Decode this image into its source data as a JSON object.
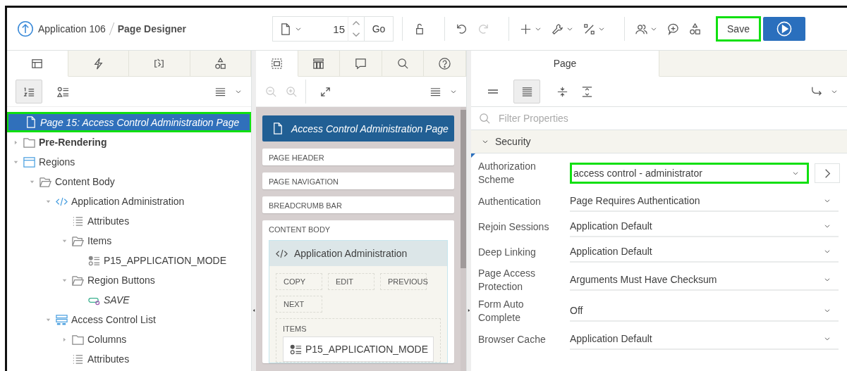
{
  "header": {
    "app_link": "Application 106",
    "page_title": "Page Designer",
    "page_number": "15",
    "go_label": "Go",
    "tool_groups": [
      [
        {
          "kind": "lock",
          "menu": false,
          "disabled": false
        }
      ],
      [
        {
          "kind": "undo",
          "menu": false,
          "disabled": false
        },
        {
          "kind": "redo",
          "menu": false,
          "disabled": true
        }
      ],
      [
        {
          "kind": "add",
          "menu": true,
          "disabled": false
        },
        {
          "kind": "utilities",
          "menu": true,
          "disabled": false
        },
        {
          "kind": "shared",
          "menu": true,
          "disabled": false
        }
      ],
      [
        {
          "kind": "team",
          "menu": true,
          "disabled": false
        },
        {
          "kind": "comment",
          "menu": false,
          "disabled": false
        },
        {
          "kind": "shapes",
          "menu": false,
          "disabled": false
        }
      ]
    ],
    "save": {
      "label": "Save",
      "highlighted": true
    }
  },
  "left_panel": {
    "tabs": [
      {
        "kind": "rendering",
        "selected": true
      },
      {
        "kind": "dynamic-actions",
        "selected": false
      },
      {
        "kind": "processing",
        "selected": false
      },
      {
        "kind": "shared-components",
        "selected": false
      }
    ],
    "view_toggles": [
      {
        "kind": "numbered",
        "selected": true
      },
      {
        "kind": "shapes-list",
        "selected": false
      }
    ],
    "tree": [
      {
        "label": "Page 15: Access Control Administration Page",
        "kind": "page",
        "bold": false,
        "italic": true,
        "selected": true,
        "highlighted": true,
        "children": [
          {
            "label": "Pre-Rendering",
            "kind": "folder",
            "bold": true,
            "italic": false,
            "selected": false,
            "highlighted": false,
            "expanded": false
          },
          {
            "label": "Regions",
            "kind": "region",
            "bold": false,
            "italic": false,
            "selected": false,
            "highlighted": false,
            "expanded": true,
            "children": [
              {
                "label": "Content Body",
                "kind": "folder-open",
                "bold": false,
                "italic": false,
                "selected": false,
                "highlighted": false,
                "expanded": true,
                "children": [
                  {
                    "label": "Application Administration",
                    "kind": "code",
                    "bold": false,
                    "italic": false,
                    "selected": false,
                    "highlighted": false,
                    "expanded": true,
                    "children": [
                      {
                        "label": "Attributes",
                        "kind": "attributes",
                        "bold": false,
                        "italic": false,
                        "selected": false,
                        "highlighted": false
                      },
                      {
                        "label": "Items",
                        "kind": "folder-open",
                        "bold": false,
                        "italic": false,
                        "selected": false,
                        "highlighted": false,
                        "expanded": true,
                        "children": [
                          {
                            "label": "P15_APPLICATION_MODE",
                            "kind": "item",
                            "bold": false,
                            "italic": false,
                            "selected": false,
                            "highlighted": false
                          }
                        ]
                      },
                      {
                        "label": "Region Buttons",
                        "kind": "folder-open",
                        "bold": false,
                        "italic": false,
                        "selected": false,
                        "highlighted": false,
                        "expanded": true,
                        "children": [
                          {
                            "label": "SAVE",
                            "kind": "button",
                            "bold": false,
                            "italic": true,
                            "selected": false,
                            "highlighted": false
                          }
                        ]
                      }
                    ]
                  },
                  {
                    "label": "Access Control List",
                    "kind": "list-region",
                    "bold": false,
                    "italic": false,
                    "selected": false,
                    "highlighted": false,
                    "expanded": true,
                    "children": [
                      {
                        "label": "Columns",
                        "kind": "folder",
                        "bold": false,
                        "italic": false,
                        "selected": false,
                        "highlighted": false,
                        "expanded": false
                      },
                      {
                        "label": "Attributes",
                        "kind": "attributes",
                        "bold": false,
                        "italic": false,
                        "selected": false,
                        "highlighted": false
                      }
                    ]
                  }
                ]
              }
            ]
          }
        ]
      }
    ]
  },
  "center_panel": {
    "tabs": [
      {
        "kind": "layout",
        "selected": true
      },
      {
        "kind": "gallery",
        "selected": false
      },
      {
        "kind": "comments",
        "selected": false
      },
      {
        "kind": "search",
        "selected": false
      },
      {
        "kind": "help",
        "selected": false
      }
    ],
    "zoom_tools": [
      {
        "kind": "zoom-out",
        "disabled": true
      },
      {
        "kind": "zoom-in",
        "disabled": true
      },
      {
        "kind": "expand",
        "disabled": false
      }
    ],
    "page_title": "Access Control Administration Page",
    "positions": [
      {
        "label": "PAGE HEADER"
      },
      {
        "label": "PAGE NAVIGATION"
      },
      {
        "label": "BREADCRUMB BAR"
      },
      {
        "label": "CONTENT BODY",
        "regions": [
          {
            "title": "Application Administration",
            "buttons": [
              "COPY",
              "EDIT",
              "PREVIOUS",
              "NEXT"
            ],
            "items_label": "ITEMS",
            "items": [
              "P15_APPLICATION_MODE"
            ]
          }
        ]
      }
    ]
  },
  "right_panel": {
    "tabs": [
      {
        "label": "Page",
        "selected": true
      }
    ],
    "view_modes": [
      {
        "kind": "show-common",
        "selected": false
      },
      {
        "kind": "show-all",
        "selected": true
      }
    ],
    "filter_placeholder": "Filter Properties",
    "groups": [
      {
        "title": "Security",
        "expanded": true,
        "properties": [
          {
            "label": "Authorization Scheme",
            "value": "access control - administrator",
            "highlighted": true,
            "has_link": true
          },
          {
            "label": "Authentication",
            "value": "Page Requires Authentication",
            "highlighted": false,
            "has_link": false
          },
          {
            "label": "Rejoin Sessions",
            "value": "Application Default",
            "highlighted": false,
            "has_link": false
          },
          {
            "label": "Deep Linking",
            "value": "Application Default",
            "highlighted": false,
            "has_link": false
          },
          {
            "label": "Page Access Protection",
            "value": "Arguments Must Have Checksum",
            "highlighted": false,
            "has_link": false
          },
          {
            "label": "Form Auto Complete",
            "value": "Off",
            "highlighted": false,
            "has_link": false
          },
          {
            "label": "Browser Cache",
            "value": "Application Default",
            "highlighted": false,
            "has_link": false
          }
        ]
      }
    ]
  }
}
